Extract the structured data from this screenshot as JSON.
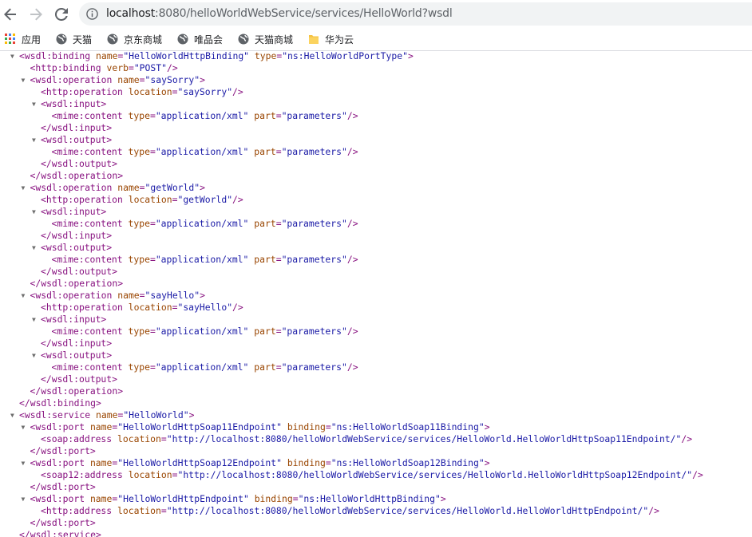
{
  "browser": {
    "url_host": "localhost",
    "url_path": ":8080/helloWorldWebService/services/HelloWorld?wsdl"
  },
  "bookmarks": [
    {
      "label": "应用",
      "icon": "apps-grid-icon"
    },
    {
      "label": "天猫",
      "icon": "globe-icon"
    },
    {
      "label": "京东商城",
      "icon": "globe-icon"
    },
    {
      "label": "唯品会",
      "icon": "globe-icon"
    },
    {
      "label": "天猫商城",
      "icon": "globe-icon"
    },
    {
      "label": "华为云",
      "icon": "folder-icon"
    }
  ],
  "xml_lines": [
    {
      "indent": 0,
      "toggle": true,
      "parts": [
        [
          "t",
          "<wsdl:binding "
        ],
        [
          "a",
          "name"
        ],
        [
          "t",
          "="
        ],
        [
          "v",
          "\"HelloWorldHttpBinding\""
        ],
        [
          "t",
          " "
        ],
        [
          "a",
          "type"
        ],
        [
          "t",
          "="
        ],
        [
          "v",
          "\"ns:HelloWorldPortType\""
        ],
        [
          "t",
          ">"
        ]
      ]
    },
    {
      "indent": 1,
      "toggle": false,
      "parts": [
        [
          "t",
          "<http:binding "
        ],
        [
          "a",
          "verb"
        ],
        [
          "t",
          "="
        ],
        [
          "v",
          "\"POST\""
        ],
        [
          "t",
          "/>"
        ]
      ]
    },
    {
      "indent": 1,
      "toggle": true,
      "parts": [
        [
          "t",
          "<wsdl:operation "
        ],
        [
          "a",
          "name"
        ],
        [
          "t",
          "="
        ],
        [
          "v",
          "\"saySorry\""
        ],
        [
          "t",
          ">"
        ]
      ]
    },
    {
      "indent": 2,
      "toggle": false,
      "parts": [
        [
          "t",
          "<http:operation "
        ],
        [
          "a",
          "location"
        ],
        [
          "t",
          "="
        ],
        [
          "v",
          "\"saySorry\""
        ],
        [
          "t",
          "/>"
        ]
      ]
    },
    {
      "indent": 2,
      "toggle": true,
      "parts": [
        [
          "t",
          "<wsdl:input>"
        ]
      ]
    },
    {
      "indent": 3,
      "toggle": false,
      "parts": [
        [
          "t",
          "<mime:content "
        ],
        [
          "a",
          "type"
        ],
        [
          "t",
          "="
        ],
        [
          "v",
          "\"application/xml\""
        ],
        [
          "t",
          " "
        ],
        [
          "a",
          "part"
        ],
        [
          "t",
          "="
        ],
        [
          "v",
          "\"parameters\""
        ],
        [
          "t",
          "/>"
        ]
      ]
    },
    {
      "indent": 2,
      "toggle": false,
      "parts": [
        [
          "t",
          "</wsdl:input>"
        ]
      ]
    },
    {
      "indent": 2,
      "toggle": true,
      "parts": [
        [
          "t",
          "<wsdl:output>"
        ]
      ]
    },
    {
      "indent": 3,
      "toggle": false,
      "parts": [
        [
          "t",
          "<mime:content "
        ],
        [
          "a",
          "type"
        ],
        [
          "t",
          "="
        ],
        [
          "v",
          "\"application/xml\""
        ],
        [
          "t",
          " "
        ],
        [
          "a",
          "part"
        ],
        [
          "t",
          "="
        ],
        [
          "v",
          "\"parameters\""
        ],
        [
          "t",
          "/>"
        ]
      ]
    },
    {
      "indent": 2,
      "toggle": false,
      "parts": [
        [
          "t",
          "</wsdl:output>"
        ]
      ]
    },
    {
      "indent": 1,
      "toggle": false,
      "parts": [
        [
          "t",
          "</wsdl:operation>"
        ]
      ]
    },
    {
      "indent": 1,
      "toggle": true,
      "parts": [
        [
          "t",
          "<wsdl:operation "
        ],
        [
          "a",
          "name"
        ],
        [
          "t",
          "="
        ],
        [
          "v",
          "\"getWorld\""
        ],
        [
          "t",
          ">"
        ]
      ]
    },
    {
      "indent": 2,
      "toggle": false,
      "parts": [
        [
          "t",
          "<http:operation "
        ],
        [
          "a",
          "location"
        ],
        [
          "t",
          "="
        ],
        [
          "v",
          "\"getWorld\""
        ],
        [
          "t",
          "/>"
        ]
      ]
    },
    {
      "indent": 2,
      "toggle": true,
      "parts": [
        [
          "t",
          "<wsdl:input>"
        ]
      ]
    },
    {
      "indent": 3,
      "toggle": false,
      "parts": [
        [
          "t",
          "<mime:content "
        ],
        [
          "a",
          "type"
        ],
        [
          "t",
          "="
        ],
        [
          "v",
          "\"application/xml\""
        ],
        [
          "t",
          " "
        ],
        [
          "a",
          "part"
        ],
        [
          "t",
          "="
        ],
        [
          "v",
          "\"parameters\""
        ],
        [
          "t",
          "/>"
        ]
      ]
    },
    {
      "indent": 2,
      "toggle": false,
      "parts": [
        [
          "t",
          "</wsdl:input>"
        ]
      ]
    },
    {
      "indent": 2,
      "toggle": true,
      "parts": [
        [
          "t",
          "<wsdl:output>"
        ]
      ]
    },
    {
      "indent": 3,
      "toggle": false,
      "parts": [
        [
          "t",
          "<mime:content "
        ],
        [
          "a",
          "type"
        ],
        [
          "t",
          "="
        ],
        [
          "v",
          "\"application/xml\""
        ],
        [
          "t",
          " "
        ],
        [
          "a",
          "part"
        ],
        [
          "t",
          "="
        ],
        [
          "v",
          "\"parameters\""
        ],
        [
          "t",
          "/>"
        ]
      ]
    },
    {
      "indent": 2,
      "toggle": false,
      "parts": [
        [
          "t",
          "</wsdl:output>"
        ]
      ]
    },
    {
      "indent": 1,
      "toggle": false,
      "parts": [
        [
          "t",
          "</wsdl:operation>"
        ]
      ]
    },
    {
      "indent": 1,
      "toggle": true,
      "parts": [
        [
          "t",
          "<wsdl:operation "
        ],
        [
          "a",
          "name"
        ],
        [
          "t",
          "="
        ],
        [
          "v",
          "\"sayHello\""
        ],
        [
          "t",
          ">"
        ]
      ]
    },
    {
      "indent": 2,
      "toggle": false,
      "parts": [
        [
          "t",
          "<http:operation "
        ],
        [
          "a",
          "location"
        ],
        [
          "t",
          "="
        ],
        [
          "v",
          "\"sayHello\""
        ],
        [
          "t",
          "/>"
        ]
      ]
    },
    {
      "indent": 2,
      "toggle": true,
      "parts": [
        [
          "t",
          "<wsdl:input>"
        ]
      ]
    },
    {
      "indent": 3,
      "toggle": false,
      "parts": [
        [
          "t",
          "<mime:content "
        ],
        [
          "a",
          "type"
        ],
        [
          "t",
          "="
        ],
        [
          "v",
          "\"application/xml\""
        ],
        [
          "t",
          " "
        ],
        [
          "a",
          "part"
        ],
        [
          "t",
          "="
        ],
        [
          "v",
          "\"parameters\""
        ],
        [
          "t",
          "/>"
        ]
      ]
    },
    {
      "indent": 2,
      "toggle": false,
      "parts": [
        [
          "t",
          "</wsdl:input>"
        ]
      ]
    },
    {
      "indent": 2,
      "toggle": true,
      "parts": [
        [
          "t",
          "<wsdl:output>"
        ]
      ]
    },
    {
      "indent": 3,
      "toggle": false,
      "parts": [
        [
          "t",
          "<mime:content "
        ],
        [
          "a",
          "type"
        ],
        [
          "t",
          "="
        ],
        [
          "v",
          "\"application/xml\""
        ],
        [
          "t",
          " "
        ],
        [
          "a",
          "part"
        ],
        [
          "t",
          "="
        ],
        [
          "v",
          "\"parameters\""
        ],
        [
          "t",
          "/>"
        ]
      ]
    },
    {
      "indent": 2,
      "toggle": false,
      "parts": [
        [
          "t",
          "</wsdl:output>"
        ]
      ]
    },
    {
      "indent": 1,
      "toggle": false,
      "parts": [
        [
          "t",
          "</wsdl:operation>"
        ]
      ]
    },
    {
      "indent": 0,
      "toggle": false,
      "parts": [
        [
          "t",
          "</wsdl:binding>"
        ]
      ]
    },
    {
      "indent": 0,
      "toggle": true,
      "parts": [
        [
          "t",
          "<wsdl:service "
        ],
        [
          "a",
          "name"
        ],
        [
          "t",
          "="
        ],
        [
          "v",
          "\"HelloWorld\""
        ],
        [
          "t",
          ">"
        ]
      ]
    },
    {
      "indent": 1,
      "toggle": true,
      "parts": [
        [
          "t",
          "<wsdl:port "
        ],
        [
          "a",
          "name"
        ],
        [
          "t",
          "="
        ],
        [
          "v",
          "\"HelloWorldHttpSoap11Endpoint\""
        ],
        [
          "t",
          " "
        ],
        [
          "a",
          "binding"
        ],
        [
          "t",
          "="
        ],
        [
          "v",
          "\"ns:HelloWorldSoap11Binding\""
        ],
        [
          "t",
          ">"
        ]
      ]
    },
    {
      "indent": 2,
      "toggle": false,
      "parts": [
        [
          "t",
          "<soap:address "
        ],
        [
          "a",
          "location"
        ],
        [
          "t",
          "="
        ],
        [
          "v",
          "\"http://localhost:8080/helloWorldWebService/services/HelloWorld.HelloWorldHttpSoap11Endpoint/\""
        ],
        [
          "t",
          "/>"
        ]
      ]
    },
    {
      "indent": 1,
      "toggle": false,
      "parts": [
        [
          "t",
          "</wsdl:port>"
        ]
      ]
    },
    {
      "indent": 1,
      "toggle": true,
      "parts": [
        [
          "t",
          "<wsdl:port "
        ],
        [
          "a",
          "name"
        ],
        [
          "t",
          "="
        ],
        [
          "v",
          "\"HelloWorldHttpSoap12Endpoint\""
        ],
        [
          "t",
          " "
        ],
        [
          "a",
          "binding"
        ],
        [
          "t",
          "="
        ],
        [
          "v",
          "\"ns:HelloWorldSoap12Binding\""
        ],
        [
          "t",
          ">"
        ]
      ]
    },
    {
      "indent": 2,
      "toggle": false,
      "parts": [
        [
          "t",
          "<soap12:address "
        ],
        [
          "a",
          "location"
        ],
        [
          "t",
          "="
        ],
        [
          "v",
          "\"http://localhost:8080/helloWorldWebService/services/HelloWorld.HelloWorldHttpSoap12Endpoint/\""
        ],
        [
          "t",
          "/>"
        ]
      ]
    },
    {
      "indent": 1,
      "toggle": false,
      "parts": [
        [
          "t",
          "</wsdl:port>"
        ]
      ]
    },
    {
      "indent": 1,
      "toggle": true,
      "parts": [
        [
          "t",
          "<wsdl:port "
        ],
        [
          "a",
          "name"
        ],
        [
          "t",
          "="
        ],
        [
          "v",
          "\"HelloWorldHttpEndpoint\""
        ],
        [
          "t",
          " "
        ],
        [
          "a",
          "binding"
        ],
        [
          "t",
          "="
        ],
        [
          "v",
          "\"ns:HelloWorldHttpBinding\""
        ],
        [
          "t",
          ">"
        ]
      ]
    },
    {
      "indent": 2,
      "toggle": false,
      "parts": [
        [
          "t",
          "<http:address "
        ],
        [
          "a",
          "location"
        ],
        [
          "t",
          "="
        ],
        [
          "v",
          "\"http://localhost:8080/helloWorldWebService/services/HelloWorld.HelloWorldHttpEndpoint/\""
        ],
        [
          "t",
          "/>"
        ]
      ]
    },
    {
      "indent": 1,
      "toggle": false,
      "parts": [
        [
          "t",
          "</wsdl:port>"
        ]
      ]
    },
    {
      "indent": 0,
      "toggle": false,
      "parts": [
        [
          "t",
          "</wsdl:service>"
        ]
      ]
    }
  ]
}
